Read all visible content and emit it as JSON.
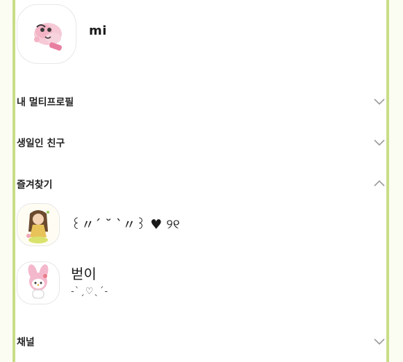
{
  "my_profile": {
    "name": "mi",
    "avatar_icon": "pink-fluffy-character-icon"
  },
  "sections": [
    {
      "label": "내 멀티프로필",
      "expanded": false
    },
    {
      "label": "생일인 친구",
      "expanded": false
    },
    {
      "label": "즐겨찾기",
      "expanded": true
    },
    {
      "label": "채널",
      "expanded": false
    }
  ],
  "favorites": [
    {
      "name": "꒰〃´ ˘ `〃꒱ ♥ ୨୧",
      "status": "",
      "avatar_icon": "girl-character-icon"
    },
    {
      "name": "벋이",
      "status": "-ˋˏ♡ˎˊ-",
      "avatar_icon": "my-melody-character-icon"
    }
  ],
  "colors": {
    "frame": "#c9dd86",
    "heart": "#ea7c8a",
    "chevron": "#9a9a9a"
  }
}
